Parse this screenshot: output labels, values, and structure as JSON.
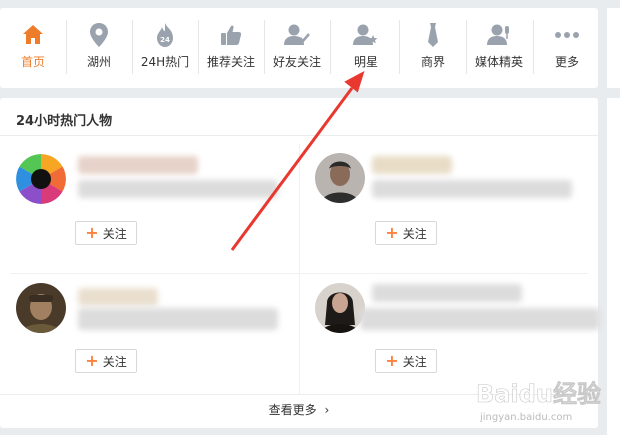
{
  "nav": {
    "items": [
      {
        "label": "首页",
        "icon": "home-icon",
        "active": true
      },
      {
        "label": "湖州",
        "icon": "location-pin-icon",
        "active": false
      },
      {
        "label": "24H热门",
        "icon": "fire-24h-icon",
        "active": false
      },
      {
        "label": "推荐关注",
        "icon": "thumbs-up-icon",
        "active": false
      },
      {
        "label": "好友关注",
        "icon": "friend-check-icon",
        "active": false
      },
      {
        "label": "明星",
        "icon": "user-star-icon",
        "active": false
      },
      {
        "label": "商界",
        "icon": "tie-icon",
        "active": false
      },
      {
        "label": "媒体精英",
        "icon": "microphone-user-icon",
        "active": false
      },
      {
        "label": "更多",
        "icon": "more-dots-icon",
        "active": false
      }
    ]
  },
  "panel": {
    "title": "24小时热门人物",
    "follow_label": "关注",
    "more_label": "查看更多",
    "more_icon": "chevron-right-icon"
  },
  "colors": {
    "accent": "#ee7d2b",
    "icon_gray": "#9aa3ad",
    "arrow": "#e8382f"
  },
  "watermark": {
    "brand": "Baidu经验",
    "url": "jingyan.baidu.com"
  }
}
